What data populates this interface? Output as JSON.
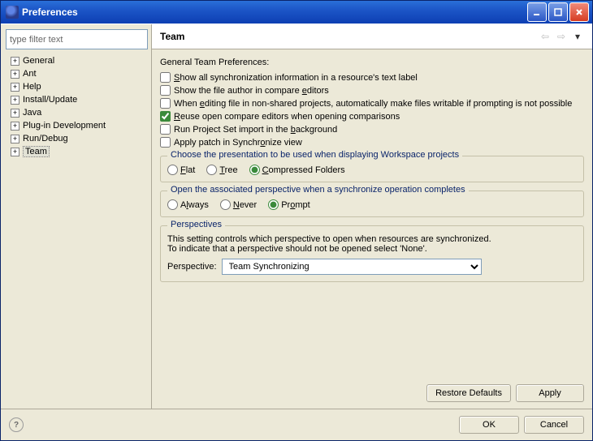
{
  "window": {
    "title": "Preferences"
  },
  "sidebar": {
    "filter_placeholder": "type filter text",
    "items": [
      {
        "label": "General"
      },
      {
        "label": "Ant"
      },
      {
        "label": "Help"
      },
      {
        "label": "Install/Update"
      },
      {
        "label": "Java"
      },
      {
        "label": "Plug-in Development"
      },
      {
        "label": "Run/Debug"
      },
      {
        "label": "Team"
      }
    ]
  },
  "page": {
    "title": "Team",
    "section_label": "General Team Preferences:",
    "checkboxes": [
      {
        "label": "Show all synchronization information in a resource's text label",
        "checked": false,
        "u": 0
      },
      {
        "label": "Show the file author in compare editors",
        "checked": false,
        "u": 30
      },
      {
        "label": "When editing file in non-shared projects, automatically make files writable if prompting is not possible",
        "checked": false,
        "u": 5
      },
      {
        "label": "Reuse open compare editors when opening comparisons",
        "checked": true,
        "u": 0
      },
      {
        "label": "Run Project Set import in the background",
        "checked": false,
        "u": 33
      },
      {
        "label": "Apply patch in Synchronize view",
        "checked": false,
        "u": 20
      }
    ],
    "group_presentation": {
      "legend": "Choose the presentation to be used when displaying Workspace projects",
      "options": [
        {
          "label": "Flat",
          "u": 0
        },
        {
          "label": "Tree",
          "u": 0
        },
        {
          "label": "Compressed Folders",
          "u": 0
        }
      ],
      "selected": 2
    },
    "group_perspective_open": {
      "legend": "Open the associated perspective when a synchronize operation completes",
      "options": [
        {
          "label": "Always",
          "u": 1
        },
        {
          "label": "Never",
          "u": 0
        },
        {
          "label": "Prompt",
          "u": 2
        }
      ],
      "selected": 2
    },
    "group_perspectives": {
      "legend": "Perspectives",
      "desc1": "This setting controls which perspective to open when resources are synchronized.",
      "desc2": "To indicate that a perspective should not be opened select 'None'.",
      "field_label": "Perspective:",
      "value": "Team Synchronizing"
    },
    "buttons": {
      "restore": "Restore Defaults",
      "apply": "Apply",
      "ok": "OK",
      "cancel": "Cancel"
    }
  }
}
